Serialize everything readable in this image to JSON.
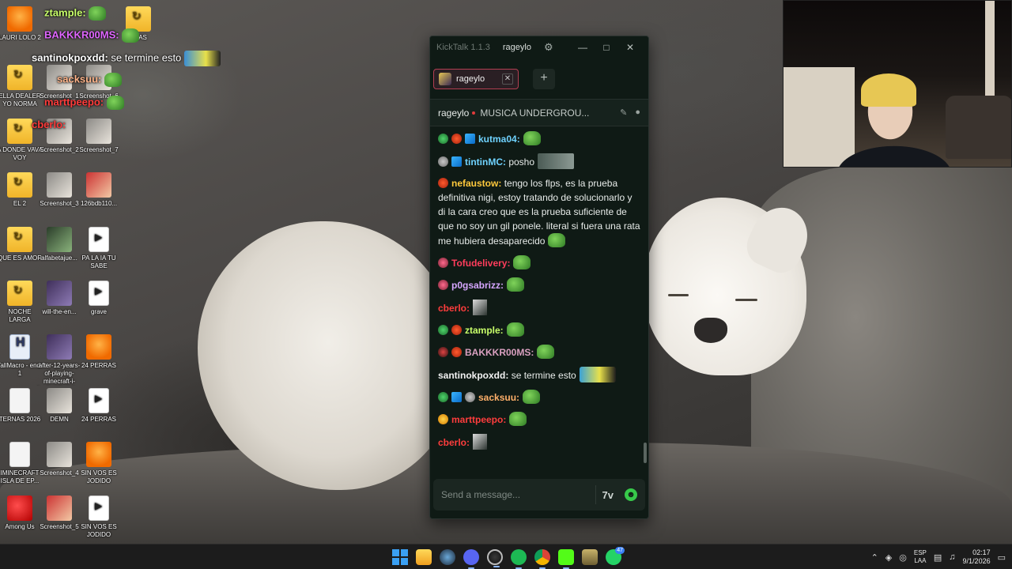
{
  "desktop": {
    "icons": [
      {
        "label": "LAURI LOLO 2",
        "kind": "fl"
      },
      {
        "label": "ELLA DEALER YO NORMA",
        "kind": "folder"
      },
      {
        "label": "Screenshot_1",
        "kind": "thumb"
      },
      {
        "label": "Screenshot_6",
        "kind": "thumb"
      },
      {
        "label": "A DONDE VAVA VOY",
        "kind": "folder"
      },
      {
        "label": "Screenshot_2",
        "kind": "thumb"
      },
      {
        "label": "Screenshot_7",
        "kind": "thumb"
      },
      {
        "label": "EL 2",
        "kind": "folder"
      },
      {
        "label": "Screenshot_3",
        "kind": "thumb"
      },
      {
        "label": "126bdb110...",
        "kind": "thumb3"
      },
      {
        "label": "QUE ES AMOR",
        "kind": "folder"
      },
      {
        "label": "alfabetajue...",
        "kind": "thumb4"
      },
      {
        "label": "PA LA IA TU SABE",
        "kind": "video"
      },
      {
        "label": "NOCHE LARGA",
        "kind": "folder"
      },
      {
        "label": "will-the-en...",
        "kind": "thumb2"
      },
      {
        "label": "grave",
        "kind": "video"
      },
      {
        "label": "TallMacro - end-1",
        "kind": "html"
      },
      {
        "label": "after-12-years-of-playing-minecraft-i-finally-killed-the-w0-zbz60Zdl0cst1",
        "kind": "thumb2"
      },
      {
        "label": "24 PERRAS",
        "kind": "fl"
      },
      {
        "label": "TERNAS 2026",
        "kind": "file"
      },
      {
        "label": "DEMN",
        "kind": "thumb"
      },
      {
        "label": "24 PERRAS",
        "kind": "video"
      },
      {
        "label": "IMINECRAFT ISLA DE EP...",
        "kind": "file"
      },
      {
        "label": "Screenshot_4",
        "kind": "thumb"
      },
      {
        "label": "SIN VOS ES JODIDO",
        "kind": "fl"
      },
      {
        "label": "Among Us",
        "kind": "amongus"
      },
      {
        "label": "Screenshot_5",
        "kind": "thumb3"
      },
      {
        "label": "SIN VOS ES JODIDO",
        "kind": "video"
      },
      {
        "label": "2...AS",
        "kind": "folder"
      }
    ],
    "overlay_chat": [
      {
        "user": "ztample:",
        "msg": "",
        "color": "#c9ff6a"
      },
      {
        "user": "BAKKKR00MS:",
        "msg": "",
        "color": "#e066ff"
      },
      {
        "user": "santinokpoxdd:",
        "msg": "se termine esto",
        "color": "#ffffff"
      },
      {
        "user": "sacksuu:",
        "msg": "",
        "color": "#ffb48a"
      },
      {
        "user": "marttpeepo:",
        "msg": "",
        "color": "#ff3b3b"
      },
      {
        "user": "cberlo:",
        "msg": "",
        "color": "#ff3b3b"
      }
    ]
  },
  "kicktalk": {
    "app_title": "KickTalk 1.1.3",
    "current_user": "rageylo",
    "tab": {
      "label": "rageylo"
    },
    "channel": {
      "name": "rageylo",
      "stream_title": "MUSICA UNDERGROU..."
    },
    "messages": [
      {
        "user": "kutma04:",
        "text": "",
        "color": "#6fd3ff",
        "badges": [
          "green",
          "red",
          "blue"
        ],
        "emote": "pepe"
      },
      {
        "user": "tintinMC:",
        "text": "posho",
        "color": "#6fd3ff",
        "badges": [
          "gray",
          "blue"
        ],
        "emote": "box"
      },
      {
        "user": "nefaustow:",
        "text": "tengo los flps, es la prueba definitiva nigi, estoy tratando de solucionarlo y di la cara creo que es la prueba suficiente de que no soy un gil ponele. literal si fuera una rata me hubiera desaparecido",
        "color": "#ffc93c",
        "badges": [
          "red"
        ],
        "emote": "pepe"
      },
      {
        "user": "Tofudelivery:",
        "text": "",
        "color": "#ff3d5c",
        "badges": [
          "pink"
        ],
        "emote": "pepe"
      },
      {
        "user": "p0gsabrizz:",
        "text": "",
        "color": "#d6a6ff",
        "badges": [
          "pink"
        ],
        "emote": "pepe"
      },
      {
        "user": "cberlo:",
        "text": "",
        "color": "#ff3d3d",
        "badges": [],
        "emote": "small"
      },
      {
        "user": "ztample:",
        "text": "",
        "color": "#c9ff6a",
        "badges": [
          "green",
          "red"
        ],
        "emote": "pepe"
      },
      {
        "user": "BAKKKR00MS:",
        "text": "",
        "color": "#d9a0c0",
        "badges": [
          "dark",
          "red"
        ],
        "emote": "pepe"
      },
      {
        "user": "santinokpoxdd:",
        "text": "se termine esto",
        "color": "#f2f2f2",
        "badges": [],
        "emote": "sign"
      },
      {
        "user": "sacksuu:",
        "text": "",
        "color": "#ffb06a",
        "badges": [
          "green",
          "blue",
          "gray"
        ],
        "emote": "pepe"
      },
      {
        "user": "marttpeepo:",
        "text": "",
        "color": "#ff3d3d",
        "badges": [
          "yellow"
        ],
        "emote": "pepe"
      },
      {
        "user": "cberlo:",
        "text": "",
        "color": "#ff3d3d",
        "badges": [],
        "emote": "small"
      }
    ],
    "input": {
      "placeholder": "Send a message..."
    },
    "seventv_label": "7v"
  },
  "taskbar": {
    "lang_top": "ESP",
    "lang_bottom": "LAA",
    "time": "02:17",
    "date": "9/1/2026",
    "whatsapp_badge": "47"
  }
}
